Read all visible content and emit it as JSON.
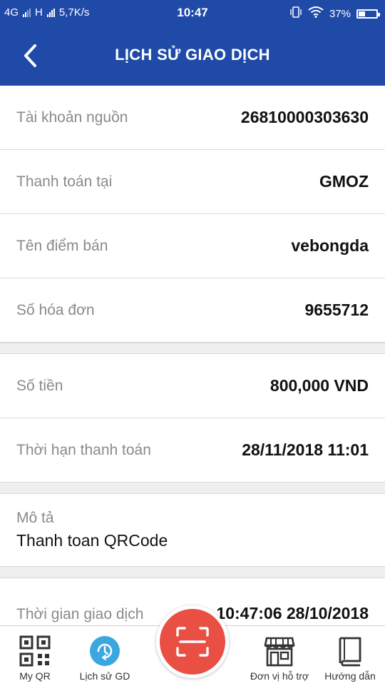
{
  "status_bar": {
    "network1": "4G",
    "network2": "H",
    "speed": "5,7K/s",
    "time": "10:47",
    "battery": "37%",
    "battery_level": 0.37
  },
  "header": {
    "title": "LỊCH SỬ GIAO DỊCH"
  },
  "details": {
    "source_account_label": "Tài khoản nguồn",
    "source_account_value": "26810000303630",
    "pay_at_label": "Thanh toán tại",
    "pay_at_value": "GMOZ",
    "merchant_label": "Tên điểm bán",
    "merchant_value": "vebongda",
    "invoice_label": "Số hóa đơn",
    "invoice_value": "9655712",
    "amount_label": "Số tiền",
    "amount_value": "800,000 VND",
    "deadline_label": "Thời hạn thanh toán",
    "deadline_value": "28/11/2018 11:01",
    "description_label": "Mô tả",
    "description_value": "Thanh toan QRCode",
    "tx_time_label": "Thời gian giao dịch",
    "tx_time_value": "10:47:06 28/10/2018"
  },
  "bottom_nav": {
    "my_qr": "My QR",
    "history": "Lịch sử GD",
    "support": "Đơn vị hỗ trợ",
    "guide": "Hướng dẫn"
  },
  "colors": {
    "header_bg": "#1f4aa8",
    "scan_button": "#ea4f44",
    "history_icon": "#3aa7e0"
  },
  "icons": {
    "back": "chevron-left-icon",
    "my_qr": "qr-code-icon",
    "history": "history-icon",
    "scan": "scan-icon",
    "support": "store-icon",
    "guide": "book-icon"
  }
}
